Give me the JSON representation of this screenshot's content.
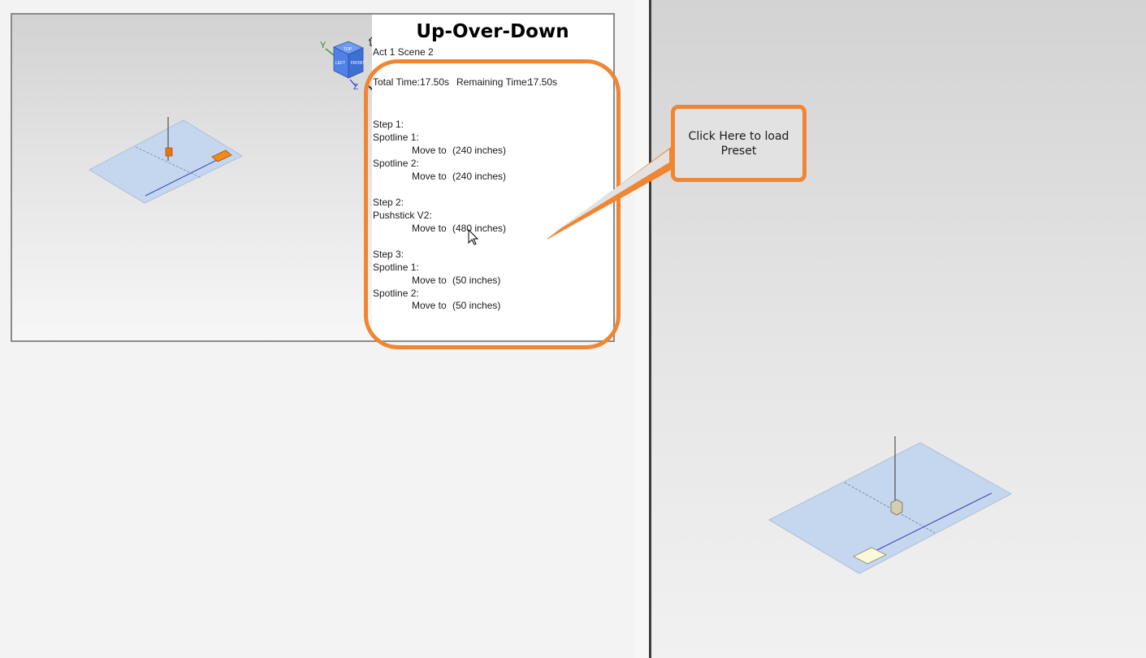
{
  "preset": {
    "title": "Up-Over-Down",
    "subtitle": "Act 1 Scene 2",
    "total_time_label": "Total Time:",
    "total_time_value": "17.50s",
    "remaining_time_label": "Remaining Time:",
    "remaining_time_value": "17.50s",
    "steps": [
      {
        "label": "Step 1:",
        "actions": [
          {
            "device": "Spotline 1:",
            "command": "Move to",
            "value": "(240 inches)"
          },
          {
            "device": "Spotline 2:",
            "command": "Move to",
            "value": "(240 inches)"
          }
        ]
      },
      {
        "label": "Step 2:",
        "actions": [
          {
            "device": "Pushstick V2:",
            "command": "Move to",
            "value": "(480 inches)"
          }
        ]
      },
      {
        "label": "Step 3:",
        "actions": [
          {
            "device": "Spotline 1:",
            "command": "Move to",
            "value": "(50 inches)"
          },
          {
            "device": "Spotline 2:",
            "command": "Move to",
            "value": "(50 inches)"
          }
        ]
      }
    ]
  },
  "view_cube": {
    "faces": [
      "TOP",
      "LEFT",
      "FRONT"
    ],
    "axes": [
      "Y",
      "Z"
    ]
  },
  "icons": {
    "home": "home-icon",
    "chevron": "chevron-down-icon",
    "cursor": "mouse-cursor-icon"
  },
  "callout": {
    "text": "Click Here to load Preset"
  },
  "colors": {
    "accent_orange": "#f08532",
    "stage_floor": "#c5d7ef",
    "scenery_orange": "#e8740c",
    "scenery_cream": "#fbf8d8"
  }
}
